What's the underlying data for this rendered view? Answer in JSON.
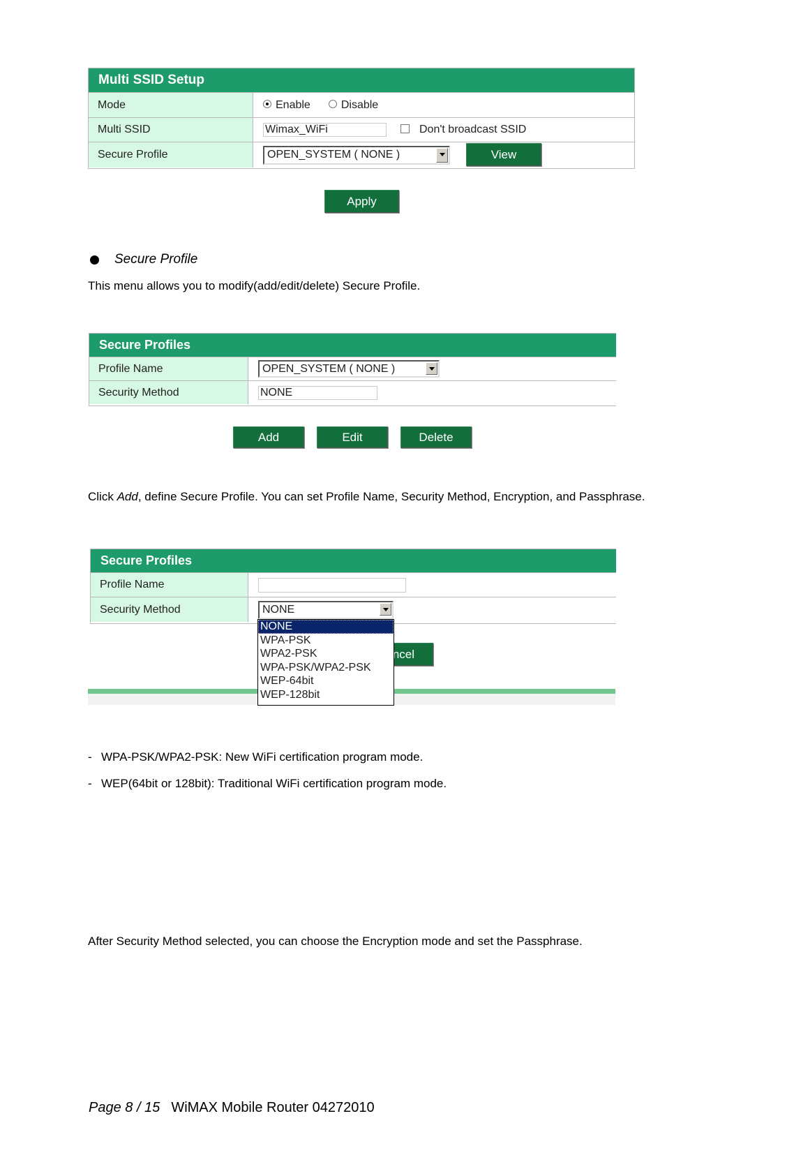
{
  "multi_ssid_panel": {
    "title": "Multi SSID Setup",
    "rows": {
      "mode": {
        "label": "Mode",
        "options": [
          "Enable",
          "Disable"
        ],
        "selected": "Enable"
      },
      "multi_ssid": {
        "label": "Multi SSID",
        "value": "Wimax_WiFi",
        "checkbox_label": "Don't broadcast SSID",
        "checked": false
      },
      "secure_profile": {
        "label": "Secure Profile",
        "selected": "OPEN_SYSTEM ( NONE )",
        "view_label": "View"
      }
    },
    "apply_label": "Apply"
  },
  "section": {
    "bullet_title": "Secure Profile",
    "intro": "This menu allows you to modify(add/edit/delete) Secure Profile."
  },
  "secure_profiles_panel": {
    "title": "Secure Profiles",
    "profile_name_label": "Profile Name",
    "profile_name_selected": "OPEN_SYSTEM ( NONE )",
    "security_method_label": "Security Method",
    "security_method_value": "NONE",
    "buttons": {
      "add": "Add",
      "edit": "Edit",
      "delete": "Delete"
    }
  },
  "click_add_text": {
    "prefix": "Click ",
    "emph": "Add",
    "suffix": ", define Secure Profile. You can set Profile Name, Security Method, Encryption, and Passphrase."
  },
  "add_profile_panel": {
    "title": "Secure Profiles",
    "profile_name_label": "Profile Name",
    "profile_name_value": "",
    "security_method_label": "Security Method",
    "security_method_selected": "NONE",
    "dropdown_options": [
      "NONE",
      "WPA-PSK",
      "WPA2-PSK",
      "WPA-PSK/WPA2-PSK",
      "WEP-64bit",
      "WEP-128bit"
    ],
    "cancel_partial_label": "ncel"
  },
  "notes": [
    "WPA-PSK/WPA2-PSK: New WiFi certification program mode.",
    "WEP(64bit or 128bit): Traditional WiFi certification program mode."
  ],
  "after_text": "After Security Method selected, you can choose the Encryption mode and set the Passphrase.",
  "footer": {
    "page": "Page 8 / 15",
    "doc_title": "WiMAX Mobile Router 04272010"
  }
}
